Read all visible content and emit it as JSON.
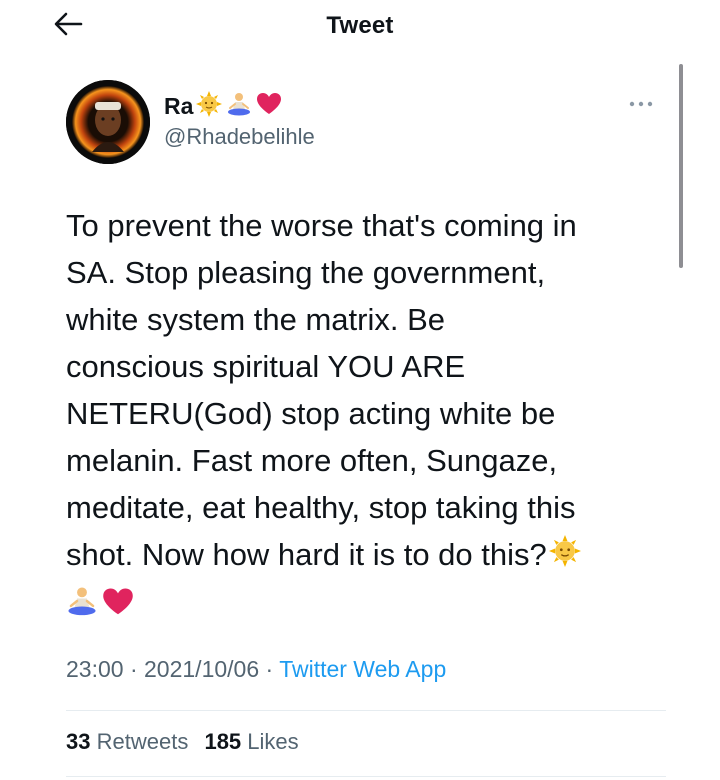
{
  "header": {
    "title": "Tweet",
    "back_icon": "arrow-left-icon"
  },
  "author": {
    "display_name": "Ra",
    "name_emojis": [
      "sun-with-face-icon",
      "person-in-lotus-position-icon",
      "red-heart-icon"
    ],
    "handle": "@Rhadebelihle"
  },
  "more_icon": "more-dots-icon",
  "tweet": {
    "lines": [
      "To prevent the worse that's coming in",
      "SA. Stop pleasing the government,",
      "white system the matrix. Be",
      "conscious spiritual YOU ARE",
      "NETERU(God) stop acting white be",
      "melanin. Fast more often, Sungaze,",
      "meditate, eat healthy, stop taking this",
      "shot. Now how hard it is to do this?"
    ],
    "trailing_emojis": [
      "sun-with-face-icon",
      "person-in-lotus-position-icon",
      "red-heart-icon"
    ]
  },
  "meta": {
    "time": "23:00",
    "separator": "·",
    "date": "2021/10/06",
    "source": "Twitter Web App"
  },
  "stats": {
    "retweets_count": "33",
    "retweets_label": "Retweets",
    "likes_count": "185",
    "likes_label": "Likes"
  },
  "colors": {
    "link": "#1d9bf0",
    "secondary_text": "#536471",
    "primary_text": "#0f1419",
    "heart": "#e0245e",
    "sun": "#f4b400"
  }
}
